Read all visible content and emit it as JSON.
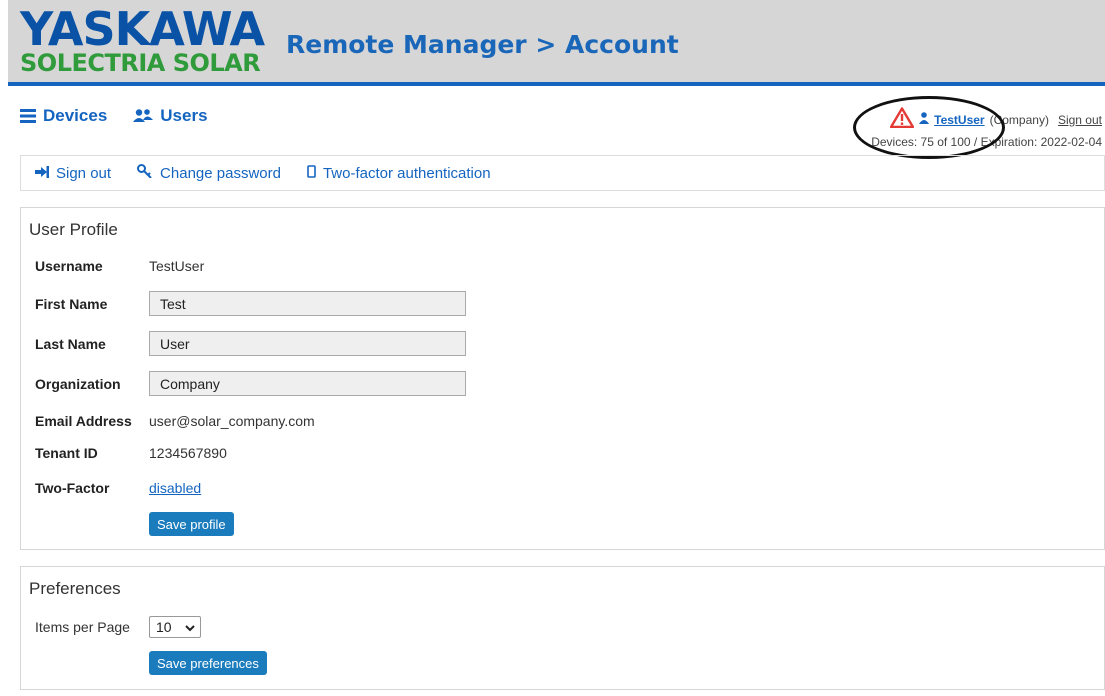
{
  "brand": {
    "logo_top": "YASKAWA",
    "logo_bottom": "SOLECTRIA SOLAR"
  },
  "header": {
    "title": "Remote Manager > Account"
  },
  "main_nav": [
    {
      "label": "Devices",
      "icon": "list-icon"
    },
    {
      "label": "Users",
      "icon": "users-icon"
    }
  ],
  "user_info": {
    "warning_icon": "warning-triangle-icon",
    "user_icon": "person-icon",
    "username": "TestUser",
    "company": "(Company)",
    "sign_out": "Sign out",
    "devices_line": "Devices: 75 of 100 / Expiration: 2022-02-04"
  },
  "sub_nav": [
    {
      "label": "Sign out",
      "icon": "sign-out-icon"
    },
    {
      "label": "Change password",
      "icon": "key-icon"
    },
    {
      "label": "Two-factor authentication",
      "icon": "mobile-icon"
    }
  ],
  "profile": {
    "title": "User Profile",
    "username": {
      "label": "Username",
      "value": "TestUser"
    },
    "first_name": {
      "label": "First Name",
      "value": "Test"
    },
    "last_name": {
      "label": "Last Name",
      "value": "User"
    },
    "organization": {
      "label": "Organization",
      "value": "Company"
    },
    "email": {
      "label": "Email Address",
      "value": "user@solar_company.com"
    },
    "tenant_id": {
      "label": "Tenant ID",
      "value": "1234567890"
    },
    "two_factor": {
      "label": "Two-Factor",
      "value": "disabled"
    },
    "save_label": "Save profile"
  },
  "preferences": {
    "title": "Preferences",
    "items_per_page": {
      "label": "Items per Page",
      "value": "10"
    },
    "save_label": "Save preferences"
  },
  "colors": {
    "accent": "#1565c0",
    "header_bg": "#d6d6d6",
    "button": "#1a7bbd",
    "warning": "#e53935",
    "logo_blue": "#0a52a5",
    "logo_green": "#2f9b3a"
  }
}
